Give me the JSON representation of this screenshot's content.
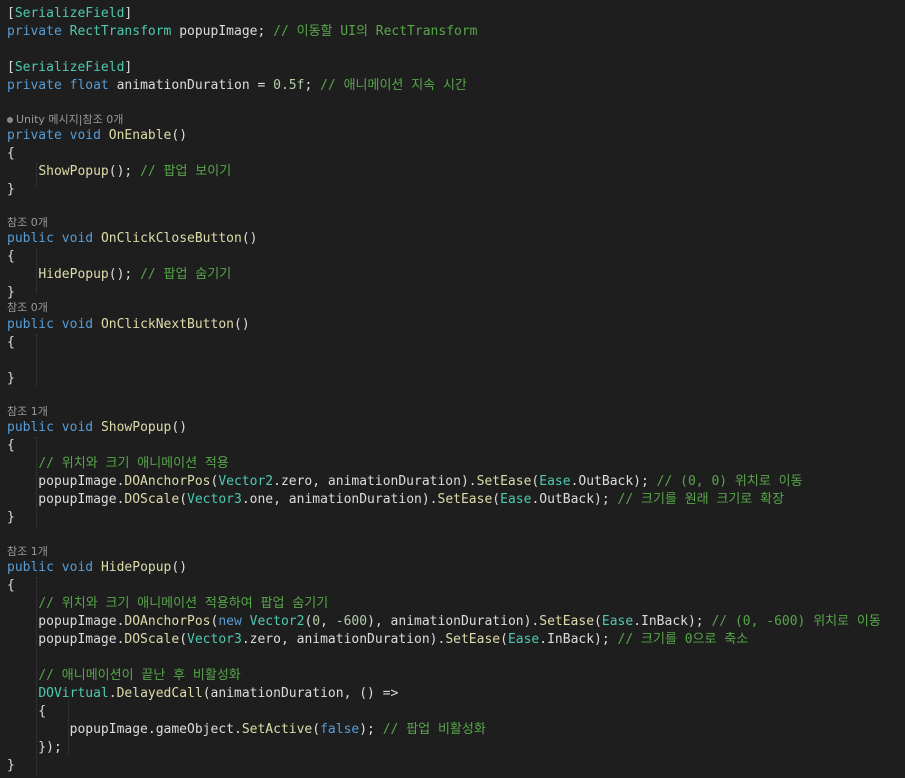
{
  "colors": {
    "background": "#1e1e1e",
    "keyword": "#569cd6",
    "type": "#4ec9b0",
    "method": "#dcdcaa",
    "comment": "#57a64a",
    "number": "#b5cea8",
    "plain": "#dcdcdc",
    "codelens": "#999999"
  },
  "lines": [
    {
      "tokens": [
        {
          "t": "[",
          "c": "plain"
        },
        {
          "t": "SerializeField",
          "c": "type"
        },
        {
          "t": "]",
          "c": "plain"
        }
      ]
    },
    {
      "tokens": [
        {
          "t": "private",
          "c": "keyword"
        },
        {
          "t": " ",
          "c": "plain"
        },
        {
          "t": "RectTransform",
          "c": "type"
        },
        {
          "t": " popupImage; ",
          "c": "plain"
        },
        {
          "t": "// 이동할 UI의 RectTransform",
          "c": "comment"
        }
      ]
    },
    {
      "tokens": []
    },
    {
      "tokens": [
        {
          "t": "[",
          "c": "plain"
        },
        {
          "t": "SerializeField",
          "c": "type"
        },
        {
          "t": "]",
          "c": "plain"
        }
      ]
    },
    {
      "tokens": [
        {
          "t": "private",
          "c": "keyword"
        },
        {
          "t": " ",
          "c": "plain"
        },
        {
          "t": "float",
          "c": "keyword"
        },
        {
          "t": " animationDuration = ",
          "c": "plain"
        },
        {
          "t": "0.5f",
          "c": "number"
        },
        {
          "t": "; ",
          "c": "plain"
        },
        {
          "t": "// 애니메이션 지속 시간",
          "c": "comment"
        }
      ]
    },
    {
      "tokens": []
    },
    {
      "lens": "Unity 메시지|참조 0개",
      "unity": true
    },
    {
      "tokens": [
        {
          "t": "private",
          "c": "keyword"
        },
        {
          "t": " ",
          "c": "plain"
        },
        {
          "t": "void",
          "c": "keyword"
        },
        {
          "t": " ",
          "c": "plain"
        },
        {
          "t": "OnEnable",
          "c": "method"
        },
        {
          "t": "()",
          "c": "plain"
        }
      ]
    },
    {
      "tokens": [
        {
          "t": "{",
          "c": "plain"
        }
      ]
    },
    {
      "tokens": [
        {
          "t": "    ",
          "c": "plain"
        },
        {
          "t": "ShowPopup",
          "c": "method"
        },
        {
          "t": "(); ",
          "c": "plain"
        },
        {
          "t": "// 팝업 보이기",
          "c": "comment"
        }
      ]
    },
    {
      "tokens": [
        {
          "t": "}",
          "c": "plain"
        }
      ]
    },
    {
      "tokens": []
    },
    {
      "lens": "참조 0개"
    },
    {
      "tokens": [
        {
          "t": "public",
          "c": "keyword"
        },
        {
          "t": " ",
          "c": "plain"
        },
        {
          "t": "void",
          "c": "keyword"
        },
        {
          "t": " ",
          "c": "plain"
        },
        {
          "t": "OnClickCloseButton",
          "c": "method"
        },
        {
          "t": "()",
          "c": "plain"
        }
      ]
    },
    {
      "tokens": [
        {
          "t": "{",
          "c": "plain"
        }
      ]
    },
    {
      "tokens": [
        {
          "t": "    ",
          "c": "plain"
        },
        {
          "t": "HidePopup",
          "c": "method"
        },
        {
          "t": "(); ",
          "c": "plain"
        },
        {
          "t": "// 팝업 숨기기",
          "c": "comment"
        }
      ]
    },
    {
      "tokens": [
        {
          "t": "}",
          "c": "plain"
        }
      ]
    },
    {
      "lens": "참조 0개"
    },
    {
      "tokens": [
        {
          "t": "public",
          "c": "keyword"
        },
        {
          "t": " ",
          "c": "plain"
        },
        {
          "t": "void",
          "c": "keyword"
        },
        {
          "t": " ",
          "c": "plain"
        },
        {
          "t": "OnClickNextButton",
          "c": "method"
        },
        {
          "t": "()",
          "c": "plain"
        }
      ]
    },
    {
      "tokens": [
        {
          "t": "{",
          "c": "plain"
        }
      ]
    },
    {
      "tokens": []
    },
    {
      "tokens": [
        {
          "t": "}",
          "c": "plain"
        }
      ]
    },
    {
      "tokens": []
    },
    {
      "lens": "참조 1개"
    },
    {
      "tokens": [
        {
          "t": "public",
          "c": "keyword"
        },
        {
          "t": " ",
          "c": "plain"
        },
        {
          "t": "void",
          "c": "keyword"
        },
        {
          "t": " ",
          "c": "plain"
        },
        {
          "t": "ShowPopup",
          "c": "method"
        },
        {
          "t": "()",
          "c": "plain"
        }
      ]
    },
    {
      "tokens": [
        {
          "t": "{",
          "c": "plain"
        }
      ]
    },
    {
      "tokens": [
        {
          "t": "    ",
          "c": "plain"
        },
        {
          "t": "// 위치와 크기 애니메이션 적용",
          "c": "comment"
        }
      ]
    },
    {
      "tokens": [
        {
          "t": "    popupImage.",
          "c": "plain"
        },
        {
          "t": "DOAnchorPos",
          "c": "method"
        },
        {
          "t": "(",
          "c": "plain"
        },
        {
          "t": "Vector2",
          "c": "type"
        },
        {
          "t": ".zero, animationDuration).",
          "c": "plain"
        },
        {
          "t": "SetEase",
          "c": "method"
        },
        {
          "t": "(",
          "c": "plain"
        },
        {
          "t": "Ease",
          "c": "type"
        },
        {
          "t": ".OutBack); ",
          "c": "plain"
        },
        {
          "t": "// (0, 0) 위치로 이동",
          "c": "comment"
        }
      ]
    },
    {
      "tokens": [
        {
          "t": "    popupImage.",
          "c": "plain"
        },
        {
          "t": "DOScale",
          "c": "method"
        },
        {
          "t": "(",
          "c": "plain"
        },
        {
          "t": "Vector3",
          "c": "type"
        },
        {
          "t": ".one, animationDuration).",
          "c": "plain"
        },
        {
          "t": "SetEase",
          "c": "method"
        },
        {
          "t": "(",
          "c": "plain"
        },
        {
          "t": "Ease",
          "c": "type"
        },
        {
          "t": ".OutBack); ",
          "c": "plain"
        },
        {
          "t": "// 크기를 원래 크기로 확장",
          "c": "comment"
        }
      ]
    },
    {
      "tokens": [
        {
          "t": "}",
          "c": "plain"
        }
      ]
    },
    {
      "tokens": []
    },
    {
      "lens": "참조 1개"
    },
    {
      "tokens": [
        {
          "t": "public",
          "c": "keyword"
        },
        {
          "t": " ",
          "c": "plain"
        },
        {
          "t": "void",
          "c": "keyword"
        },
        {
          "t": " ",
          "c": "plain"
        },
        {
          "t": "HidePopup",
          "c": "method"
        },
        {
          "t": "()",
          "c": "plain"
        }
      ]
    },
    {
      "tokens": [
        {
          "t": "{",
          "c": "plain"
        }
      ]
    },
    {
      "tokens": [
        {
          "t": "    ",
          "c": "plain"
        },
        {
          "t": "// 위치와 크기 애니메이션 적용하여 팝업 숨기기",
          "c": "comment"
        }
      ]
    },
    {
      "tokens": [
        {
          "t": "    popupImage.",
          "c": "plain"
        },
        {
          "t": "DOAnchorPos",
          "c": "method"
        },
        {
          "t": "(",
          "c": "plain"
        },
        {
          "t": "new",
          "c": "keyword"
        },
        {
          "t": " ",
          "c": "plain"
        },
        {
          "t": "Vector2",
          "c": "type"
        },
        {
          "t": "(",
          "c": "plain"
        },
        {
          "t": "0",
          "c": "number"
        },
        {
          "t": ", ",
          "c": "plain"
        },
        {
          "t": "-600",
          "c": "number"
        },
        {
          "t": "), animationDuration).",
          "c": "plain"
        },
        {
          "t": "SetEase",
          "c": "method"
        },
        {
          "t": "(",
          "c": "plain"
        },
        {
          "t": "Ease",
          "c": "type"
        },
        {
          "t": ".InBack); ",
          "c": "plain"
        },
        {
          "t": "// (0, -600) 위치로 이동",
          "c": "comment"
        }
      ]
    },
    {
      "tokens": [
        {
          "t": "    popupImage.",
          "c": "plain"
        },
        {
          "t": "DOScale",
          "c": "method"
        },
        {
          "t": "(",
          "c": "plain"
        },
        {
          "t": "Vector3",
          "c": "type"
        },
        {
          "t": ".zero, animationDuration).",
          "c": "plain"
        },
        {
          "t": "SetEase",
          "c": "method"
        },
        {
          "t": "(",
          "c": "plain"
        },
        {
          "t": "Ease",
          "c": "type"
        },
        {
          "t": ".InBack); ",
          "c": "plain"
        },
        {
          "t": "// 크기를 0으로 축소",
          "c": "comment"
        }
      ]
    },
    {
      "tokens": []
    },
    {
      "tokens": [
        {
          "t": "    ",
          "c": "plain"
        },
        {
          "t": "// 애니메이션이 끝난 후 비활성화",
          "c": "comment"
        }
      ]
    },
    {
      "tokens": [
        {
          "t": "    ",
          "c": "plain"
        },
        {
          "t": "DOVirtual",
          "c": "type"
        },
        {
          "t": ".",
          "c": "plain"
        },
        {
          "t": "DelayedCall",
          "c": "method"
        },
        {
          "t": "(animationDuration, () =>",
          "c": "plain"
        }
      ]
    },
    {
      "tokens": [
        {
          "t": "    {",
          "c": "plain"
        }
      ]
    },
    {
      "tokens": [
        {
          "t": "        popupImage.gameObject.",
          "c": "plain"
        },
        {
          "t": "SetActive",
          "c": "method"
        },
        {
          "t": "(",
          "c": "plain"
        },
        {
          "t": "false",
          "c": "keyword"
        },
        {
          "t": "); ",
          "c": "plain"
        },
        {
          "t": "// 팝업 비활성화",
          "c": "comment"
        }
      ]
    },
    {
      "tokens": [
        {
          "t": "    });",
          "c": "plain"
        }
      ]
    },
    {
      "tokens": [
        {
          "t": "}",
          "c": "plain"
        }
      ]
    }
  ]
}
